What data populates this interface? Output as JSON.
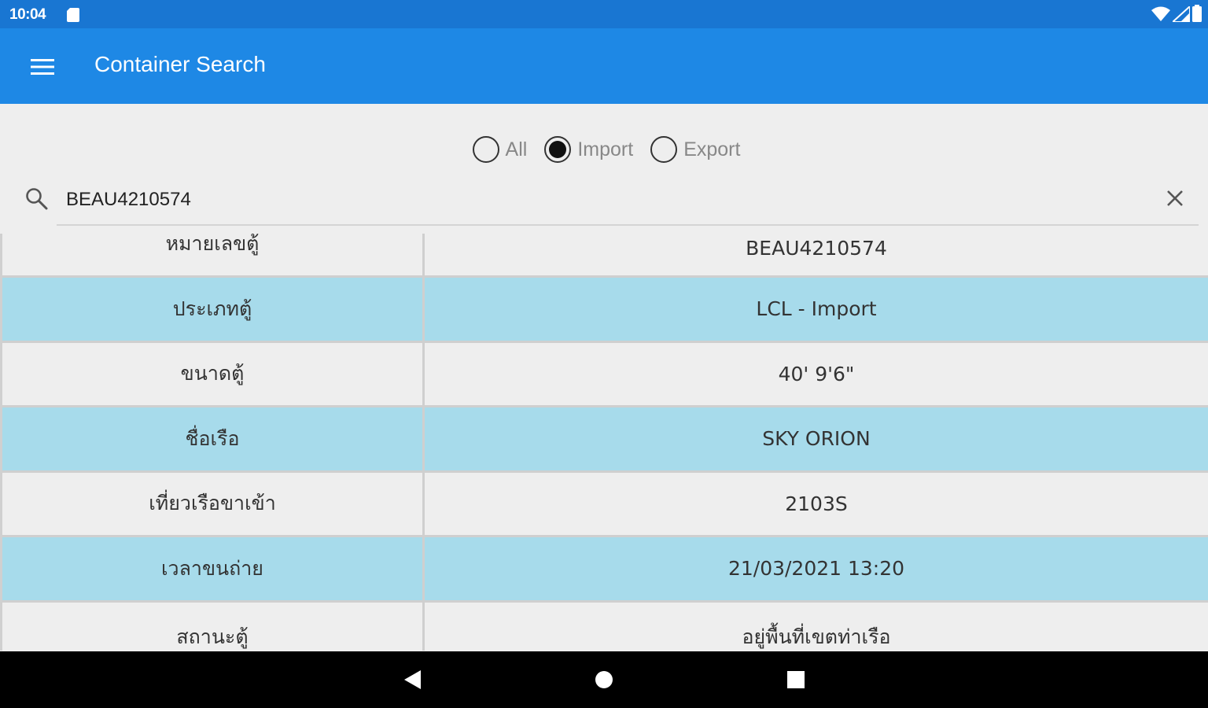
{
  "status_bar": {
    "time": "10:04",
    "icons": [
      "sd-card-icon",
      "wifi-icon",
      "signal-icon",
      "battery-icon"
    ]
  },
  "app_bar": {
    "title": "Container Search",
    "menu_icon": "hamburger-menu-icon"
  },
  "filter": {
    "options": [
      {
        "label": "All",
        "selected": false
      },
      {
        "label": "Import",
        "selected": true
      },
      {
        "label": "Export",
        "selected": false
      }
    ]
  },
  "search": {
    "value": "BEAU4210574",
    "icon": "search-icon",
    "clear_icon": "close-icon"
  },
  "details": {
    "rows": [
      {
        "label": "หมายเลขตู้",
        "value": "BEAU4210574"
      },
      {
        "label": "ประเภทตู้",
        "value": "LCL - Import"
      },
      {
        "label": "ขนาดตู้",
        "value": "40' 9'6\""
      },
      {
        "label": "ชื่อเรือ",
        "value": "SKY ORION"
      },
      {
        "label": "เที่ยวเรือขาเข้า",
        "value": "2103S"
      },
      {
        "label": "เวลาขนถ่าย",
        "value": "21/03/2021 13:20"
      },
      {
        "label": "สถานะตู้",
        "value": "อยู่พื้นที่เขตท่าเรือ"
      }
    ]
  },
  "colors": {
    "status_bar": "#1976d2",
    "app_bar": "#1e88e5",
    "row_shade": "#a7dbeb",
    "background": "#eeeeee"
  },
  "nav_bar": {
    "buttons": [
      "back-icon",
      "home-icon",
      "recents-icon"
    ]
  }
}
